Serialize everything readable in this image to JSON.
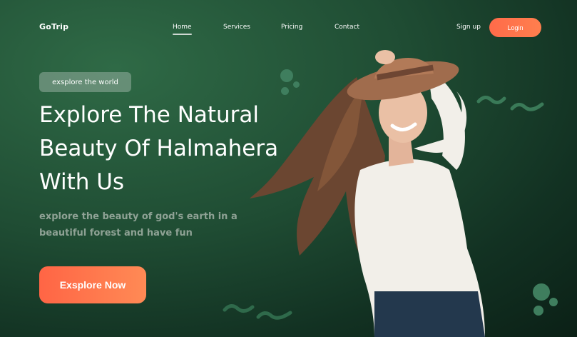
{
  "nav": {
    "logo": "GoTrip",
    "items": [
      {
        "label": "Home",
        "active": true
      },
      {
        "label": "Services",
        "active": false
      },
      {
        "label": "Pricing",
        "active": false
      },
      {
        "label": "Contact",
        "active": false
      }
    ],
    "signup": "Sign up",
    "login": "Login"
  },
  "hero": {
    "pill": "exsplore the world",
    "headline_line1": "Explore The Natural",
    "headline_line2": "Beauty Of Halmahera",
    "headline_line3": "With Us",
    "subtitle_line1": "explore the beauty of god's earth in a",
    "subtitle_line2": "beautiful forest and have fun",
    "cta": "Exsplore Now"
  },
  "colors": {
    "accent": "#ff6b4a",
    "background": "#1f4c33"
  }
}
